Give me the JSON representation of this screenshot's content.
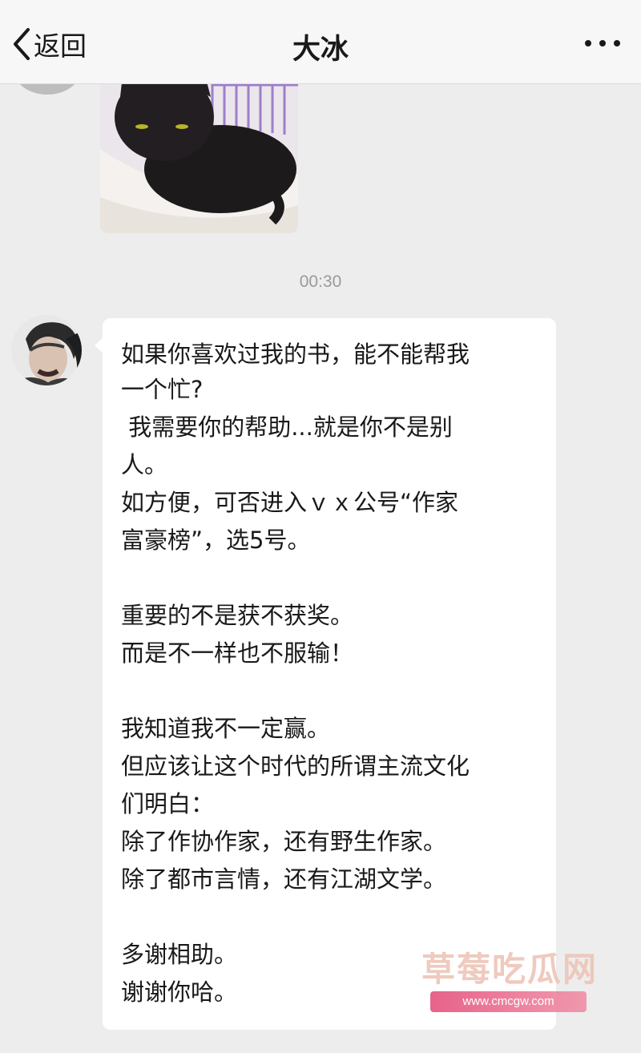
{
  "nav": {
    "back_label": "返回",
    "title": "大冰"
  },
  "messages": {
    "timestamp": "00:30",
    "text_lines": [
      "如果你喜欢过我的书，能不能帮我",
      "一个忙?",
      " 我需要你的帮助...就是你不是别",
      "人。",
      "如方便，可否进入ｖｘ公号“作家",
      "富豪榜”，选5号。",
      "",
      "重要的不是获不获奖。",
      "而是不一样也不服输！",
      "",
      "我知道我不一定赢。",
      "但应该让这个时代的所谓主流文化",
      "们明白：",
      "除了作协作家，还有野生作家。",
      "除了都市言情，还有江湖文学。",
      "",
      "多谢相助。",
      "谢谢你哈。"
    ]
  },
  "watermark": {
    "text": "草莓吃瓜网",
    "url": "www.cmcgw.com"
  },
  "icons": {
    "back": "chevron-left-icon",
    "more": "more-icon"
  }
}
